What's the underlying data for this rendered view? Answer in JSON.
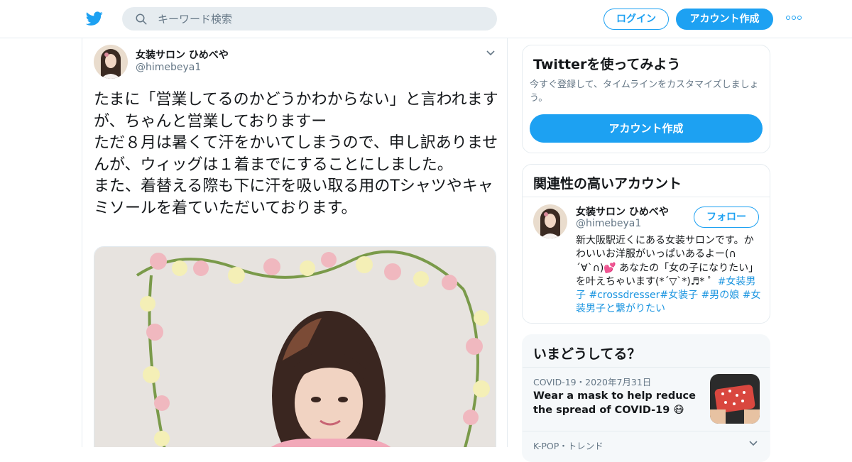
{
  "colors": {
    "accent": "#1da1f2",
    "text": "#14171a",
    "muted": "#657786",
    "border": "#e6ecf0",
    "hashtag": "#1b95e0"
  },
  "header": {
    "logo_icon": "twitter-bird-icon",
    "search_placeholder": "キーワード検索",
    "login_label": "ログイン",
    "signup_label": "アカウント作成",
    "more_icon": "more-dots-icon"
  },
  "tweet": {
    "author_name": "女装サロン ひめべや",
    "author_handle": "@himebeya1",
    "text": "たまに「営業してるのかどうかわからない」と言われますが、ちゃんと営業しておりますー\nただ８月は暑くて汗をかいてしまうので、申し訳ありませんが、ウィッグは１着までにすることにしました。\nまた、着替える際も下に汗を吸い取る用のTシャツやキャミソールを着ていただいております。",
    "media_icon": "photo-image"
  },
  "sidebar": {
    "try_card": {
      "title": "Twitterを使ってみよう",
      "description": "今すぐ登録して、タイムラインをカスタマイズしましょう。",
      "cta_label": "アカウント作成"
    },
    "relevant_card": {
      "title": "関連性の高いアカウント",
      "account_name": "女装サロン ひめべや",
      "account_handle": "@himebeya1",
      "follow_label": "フォロー",
      "bio_text": "新大阪駅近くにある女装サロンです。かわいいお洋服がいっぱいあるよー(∩´∀`∩)💕 あなたの「女の子になりたい」を叶えちゃいます(*´▽`*)♬* ゜",
      "bio_hashtags": [
        "#女装男子",
        "#crossdresser",
        "#女装子",
        "#男の娘",
        "#女装男子と繋がりたい"
      ]
    },
    "trends_card": {
      "title": "いまどうしてる？",
      "trend_meta": "COVID-19・2020年7月31日",
      "trend_title": "Wear a mask to help reduce the spread of COVID-19 😷",
      "trend2_meta": "K-POP・トレンド"
    }
  }
}
